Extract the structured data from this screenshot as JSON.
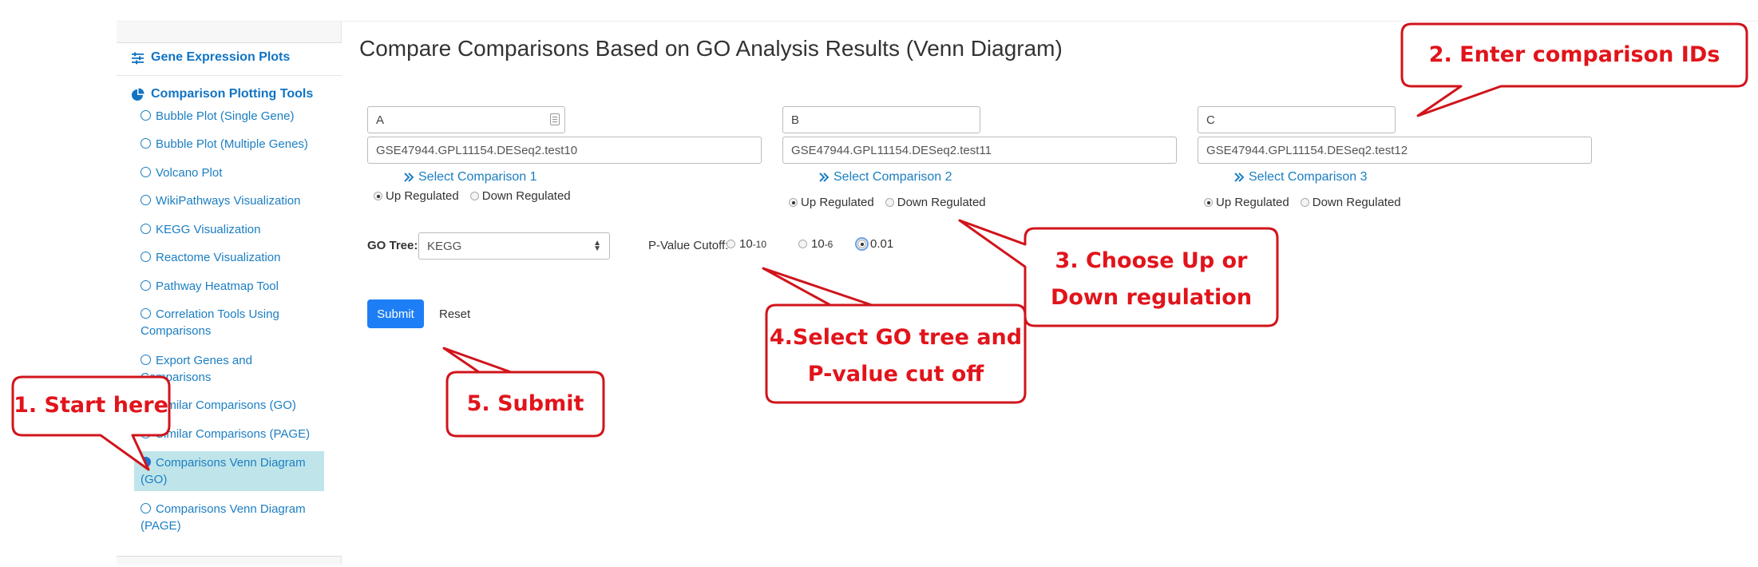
{
  "sidebar": {
    "gene_group_label": "Gene Expression Plots",
    "comparison_group_label": "Comparison Plotting Tools",
    "items": [
      {
        "label": "Bubble Plot (Single Gene)"
      },
      {
        "label": "Bubble Plot (Multiple Genes)"
      },
      {
        "label": "Volcano Plot"
      },
      {
        "label": "WikiPathways Visualization"
      },
      {
        "label": "KEGG Visualization"
      },
      {
        "label": "Reactome Visualization"
      },
      {
        "label": "Pathway Heatmap Tool"
      },
      {
        "label": "Correlation Tools Using Comparisons"
      },
      {
        "label": "Export Genes and Comparisons"
      },
      {
        "label": "Similar Comparisons (GO)"
      },
      {
        "label": "Similar Comparisons (PAGE)"
      },
      {
        "label": "Comparisons Venn Diagram (GO)",
        "active": true
      },
      {
        "label": "Comparisons Venn Diagram (PAGE)"
      }
    ]
  },
  "main": {
    "title": "Compare Comparisons Based on GO Analysis Results (Venn Diagram)",
    "comparisons": [
      {
        "name": "A",
        "id": "GSE47944.GPL11154.DESeq2.test10",
        "select_label": "Select Comparison 1",
        "direction": "up"
      },
      {
        "name": "B",
        "id": "GSE47944.GPL11154.DESeq2.test11",
        "select_label": "Select Comparison 2",
        "direction": "up"
      },
      {
        "name": "C",
        "id": "GSE47944.GPL11154.DESeq2.test12",
        "select_label": "Select Comparison 3",
        "direction": "up"
      }
    ],
    "up_label": "Up Regulated",
    "down_label": "Down Regulated",
    "go_tree_label": "GO Tree:",
    "go_tree_value": "KEGG",
    "pvalue_label": "P-Value Cutoff:",
    "pvalue_options": [
      {
        "base": "10",
        "exp": "-10"
      },
      {
        "base": "10",
        "exp": "-6"
      },
      {
        "base": "0.01",
        "exp": ""
      }
    ],
    "pvalue_selected": "0.01",
    "submit_label": "Submit",
    "reset_label": "Reset"
  },
  "callouts": {
    "c1": "1. Start here",
    "c2": "2. Enter comparison IDs",
    "c3_line1": "3. Choose Up or",
    "c3_line2": "Down regulation",
    "c4_line1": "4.Select GO tree and",
    "c4_line2": "P-value cut off",
    "c5": "5. Submit"
  },
  "colors": {
    "link": "#1b7ec2",
    "active_bg": "#bfe5ea",
    "submit_bg": "#1e7ef6",
    "callout": "#e1141b"
  }
}
